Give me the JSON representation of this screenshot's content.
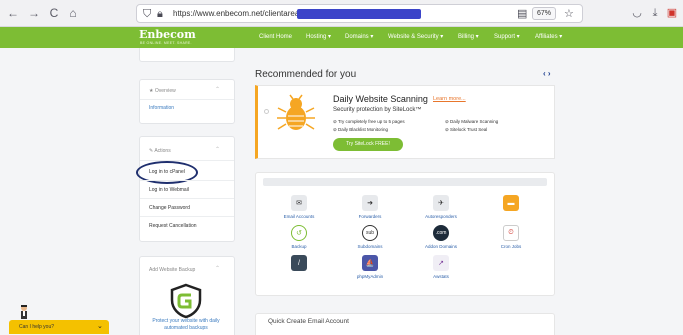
{
  "browser": {
    "back": "←",
    "forward": "→",
    "reload": "C",
    "home": "⌂",
    "url": "https://www.enbecom.net/clientarea",
    "zoom": "67%"
  },
  "site": {
    "logo": "Enbecom",
    "logo_tagline": "BE ONLINE. MEET. SHARE.",
    "menu": [
      "Client Home",
      "Hosting",
      "Domains",
      "Website & Security",
      "Billing",
      "Support",
      "Affiliates"
    ]
  },
  "sidebar": {
    "overview_head": "Overview",
    "overview_link": "Information",
    "actions_head": "Actions",
    "actions": [
      "Log in to cPanel",
      "Log in to Webmail",
      "Change Password",
      "Request Cancellation"
    ],
    "backup_head": "Add Website Backup",
    "backup_text": "Protect your website with daily automated backups"
  },
  "recommended": {
    "title": "Recommended for you",
    "arrows": "‹ ›",
    "promo_title": "Daily Website Scanning",
    "learn_more": "Learn more...",
    "promo_sub": "Security protection by SiteLock™",
    "features": [
      "Try completely free up to 5 pages",
      "Daily Blacklist Monitoring",
      "Daily Malware Scanning",
      "Sitelock Trust Seal"
    ],
    "button": "Try SiteLock FREE!"
  },
  "shortcuts": [
    {
      "label": "Email Accounts",
      "icon": "email-accounts-icon"
    },
    {
      "label": "Forwarders",
      "icon": "forwarders-icon"
    },
    {
      "label": "Autoresponders",
      "icon": "autoresponders-icon"
    },
    {
      "label": "",
      "icon": "inbox-icon"
    },
    {
      "label": "Backup",
      "icon": "backup-icon"
    },
    {
      "label": "Subdomains",
      "icon": "subdomains-icon"
    },
    {
      "label": "Addon Domains",
      "icon": "addon-domains-icon"
    },
    {
      "label": "Cron Jobs",
      "icon": "cron-jobs-icon"
    },
    {
      "label": "",
      "icon": "app-icon"
    },
    {
      "label": "phpMyAdmin",
      "icon": "phpmyadmin-icon"
    },
    {
      "label": "Awstats",
      "icon": "awstats-icon"
    }
  ],
  "quick_create": {
    "title": "Quick Create Email Account"
  },
  "chat": {
    "label": "Can I help you?",
    "chevron": "⌄"
  },
  "colors": {
    "brand": "#7dbd34",
    "accent": "#f5a623",
    "link": "#3b7bbf",
    "chat": "#f4c100"
  }
}
